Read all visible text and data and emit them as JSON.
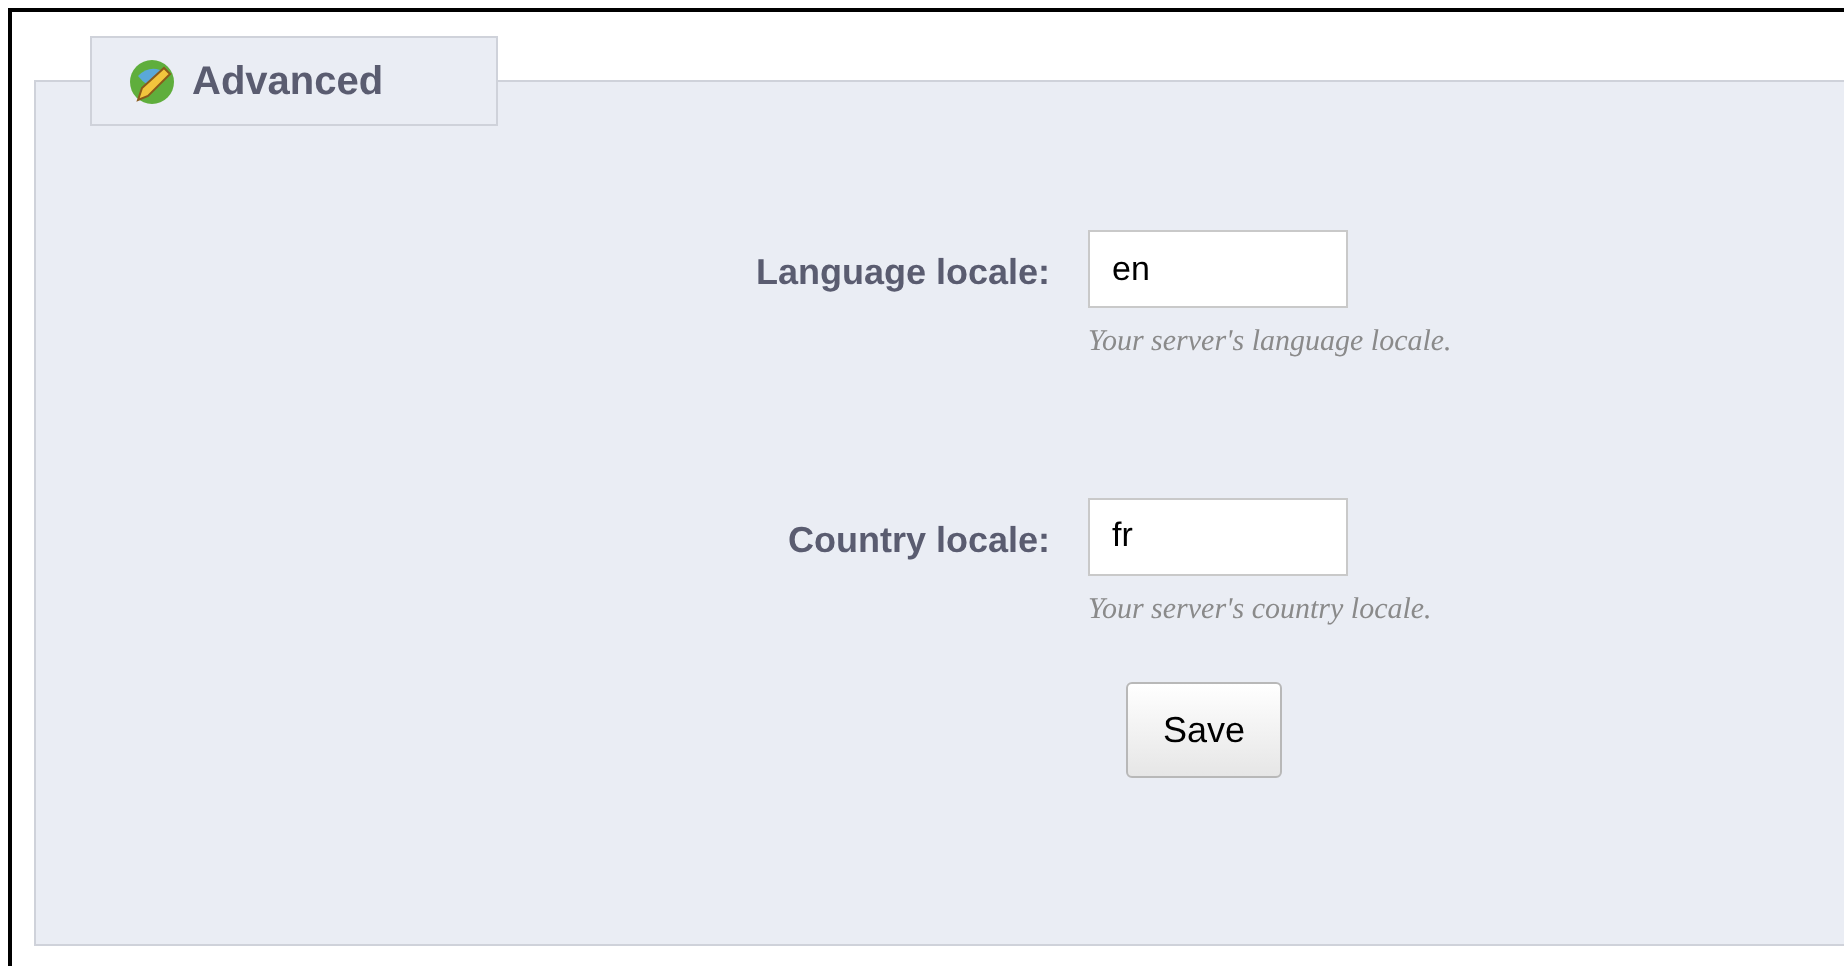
{
  "panel": {
    "legend": "Advanced"
  },
  "fields": [
    {
      "label": "Language locale:",
      "value": "en",
      "hint": "Your server's language locale."
    },
    {
      "label": "Country locale:",
      "value": "fr",
      "hint": "Your server's country locale."
    }
  ],
  "buttons": [
    {
      "label": "Save"
    }
  ]
}
